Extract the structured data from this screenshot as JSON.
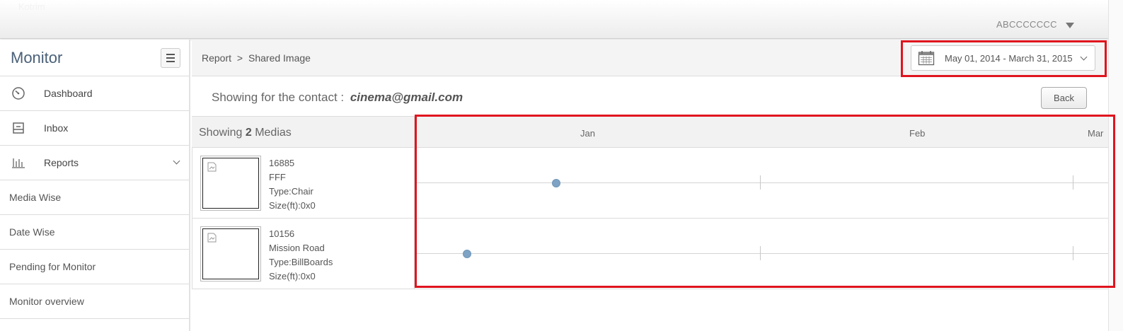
{
  "topbar": {
    "logo_text": "Kotrim",
    "user_name": "ABCCCCCCC"
  },
  "sidebar": {
    "title": "Monitor",
    "items": [
      {
        "label": "Dashboard",
        "icon": "gauge-icon"
      },
      {
        "label": "Inbox",
        "icon": "inbox-icon"
      },
      {
        "label": "Reports",
        "icon": "bar-chart-icon"
      }
    ],
    "sub_items": [
      "Media Wise",
      "Date Wise",
      "Pending for Monitor",
      "Monitor overview"
    ]
  },
  "header": {
    "breadcrumb_root": "Report",
    "breadcrumb_sep": ">",
    "breadcrumb_page": "Shared Image",
    "date_range": "May 01, 2014 - March 31, 2015"
  },
  "contact": {
    "label": "Showing for the contact :",
    "email": "cinema@gmail.com"
  },
  "back_button": "Back",
  "media_list": {
    "count_prefix": "Showing",
    "count": "2",
    "count_suffix": "Medias",
    "items": [
      {
        "id": "16885",
        "name": "FFF",
        "type": "Type:Chair",
        "size": "Size(ft):0x0",
        "share_marker_month_fraction": 0.43
      },
      {
        "id": "10156",
        "name": "Mission Road",
        "type": "Type:BillBoards",
        "size": "Size(ft):0x0",
        "share_marker_month_fraction": 0.16
      }
    ]
  },
  "timeline": {
    "months": [
      "Jan",
      "Feb",
      "Mar"
    ]
  },
  "colors": {
    "accent": "#4a6078",
    "highlight": "#e0141e",
    "dot": "#7ea3c4"
  }
}
